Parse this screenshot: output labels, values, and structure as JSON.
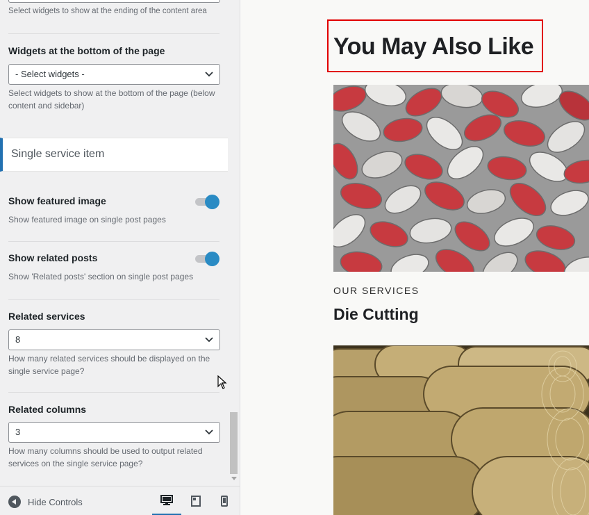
{
  "panel": {
    "top_help": "Select widgets to show at the ending of the content area",
    "bottom_widgets": {
      "title": "Widgets at the bottom of the page",
      "value": "- Select widgets -",
      "help": "Select widgets to show at the bottom of the page (below content and sidebar)"
    },
    "section": {
      "label": "Single service item"
    },
    "featured_image": {
      "title": "Show featured image",
      "help": "Show featured image on single post pages",
      "checked": true
    },
    "related_posts": {
      "title": "Show related posts",
      "help": "Show 'Related posts' section on single post pages",
      "checked": true
    },
    "related_services": {
      "title": "Related services",
      "value": "8",
      "help": "How many related services should be displayed on the single service page?"
    },
    "related_columns": {
      "title": "Related columns",
      "value": "3",
      "help": "How many columns should be used to output related services on the single service page?"
    }
  },
  "footer": {
    "hide_controls": "Hide Controls",
    "devices": [
      "desktop-icon",
      "tablet-icon",
      "mobile-icon"
    ]
  },
  "preview": {
    "heading": "You May Also Like",
    "card": {
      "category": "OUR SERVICES",
      "title": "Die Cutting"
    }
  },
  "colors": {
    "accent": "#2271b1",
    "toggle_on": "#2a8bc4",
    "highlight_border": "#e10000"
  }
}
